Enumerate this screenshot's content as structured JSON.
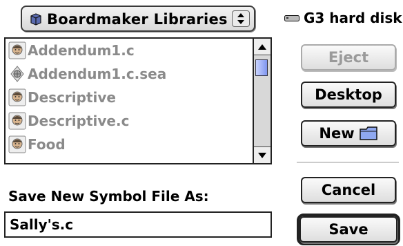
{
  "folder_popup": {
    "label": "Boardmaker Libraries",
    "icon": "folder-icon"
  },
  "volume": {
    "label": "G3 hard disk",
    "icon": "hard-disk-icon"
  },
  "file_list": {
    "items": [
      {
        "label": "Addendum1.c",
        "icon": "symbol-face-icon"
      },
      {
        "label": "Addendum1.c.sea",
        "icon": "stuffit-archive-icon"
      },
      {
        "label": "Descriptive",
        "icon": "symbol-face-icon"
      },
      {
        "label": "Descriptive.c",
        "icon": "symbol-face-icon"
      },
      {
        "label": "Food",
        "icon": "symbol-face-icon"
      }
    ]
  },
  "buttons": {
    "eject": "Eject",
    "desktop": "Desktop",
    "new": "New",
    "cancel": "Cancel",
    "save": "Save"
  },
  "save_as": {
    "label": "Save New Symbol File As:",
    "value": "Sally's.c"
  }
}
